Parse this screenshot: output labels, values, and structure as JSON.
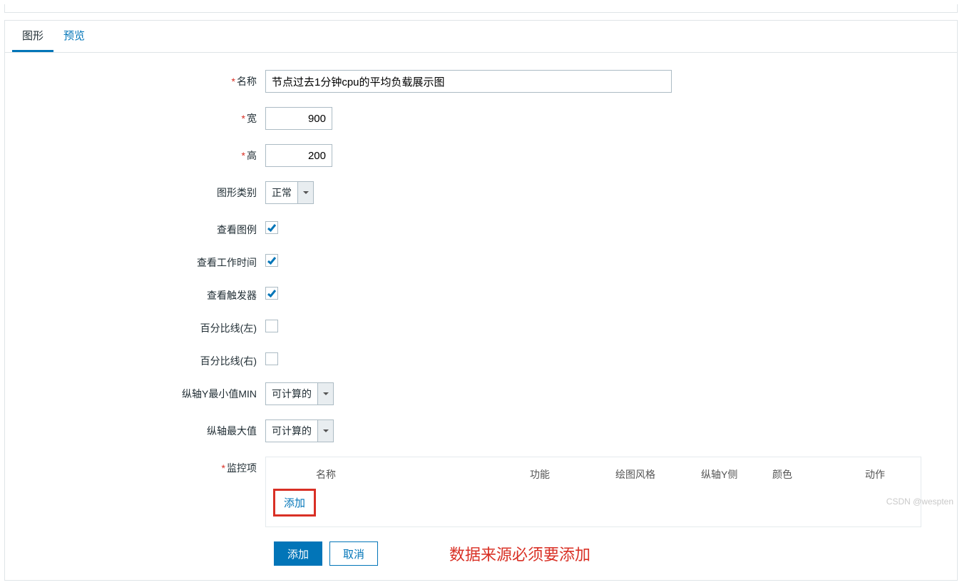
{
  "tabs": {
    "graph": "图形",
    "preview": "预览"
  },
  "labels": {
    "name": "名称",
    "width": "宽",
    "height": "高",
    "graph_type": "图形类别",
    "show_legend": "查看图例",
    "show_work_time": "查看工作时间",
    "show_triggers": "查看触发器",
    "percent_left": "百分比线(左)",
    "percent_right": "百分比线(右)",
    "y_min": "纵轴Y最小值MIN",
    "y_max": "纵轴最大值",
    "items": "监控项"
  },
  "values": {
    "name": "节点过去1分钟cpu的平均负载展示图",
    "width": "900",
    "height": "200",
    "graph_type": "正常",
    "show_legend": true,
    "show_work_time": true,
    "show_triggers": true,
    "percent_left": false,
    "percent_right": false,
    "y_min": "可计算的",
    "y_max": "可计算的"
  },
  "items_table": {
    "headers": {
      "name": "名称",
      "func": "功能",
      "draw_style": "绘图风格",
      "yaxis": "纵轴Y侧",
      "color": "颜色",
      "action": "动作"
    },
    "add_link": "添加"
  },
  "buttons": {
    "add": "添加",
    "cancel": "取消"
  },
  "annotation": "数据来源必须要添加",
  "watermark": "CSDN @wespten"
}
